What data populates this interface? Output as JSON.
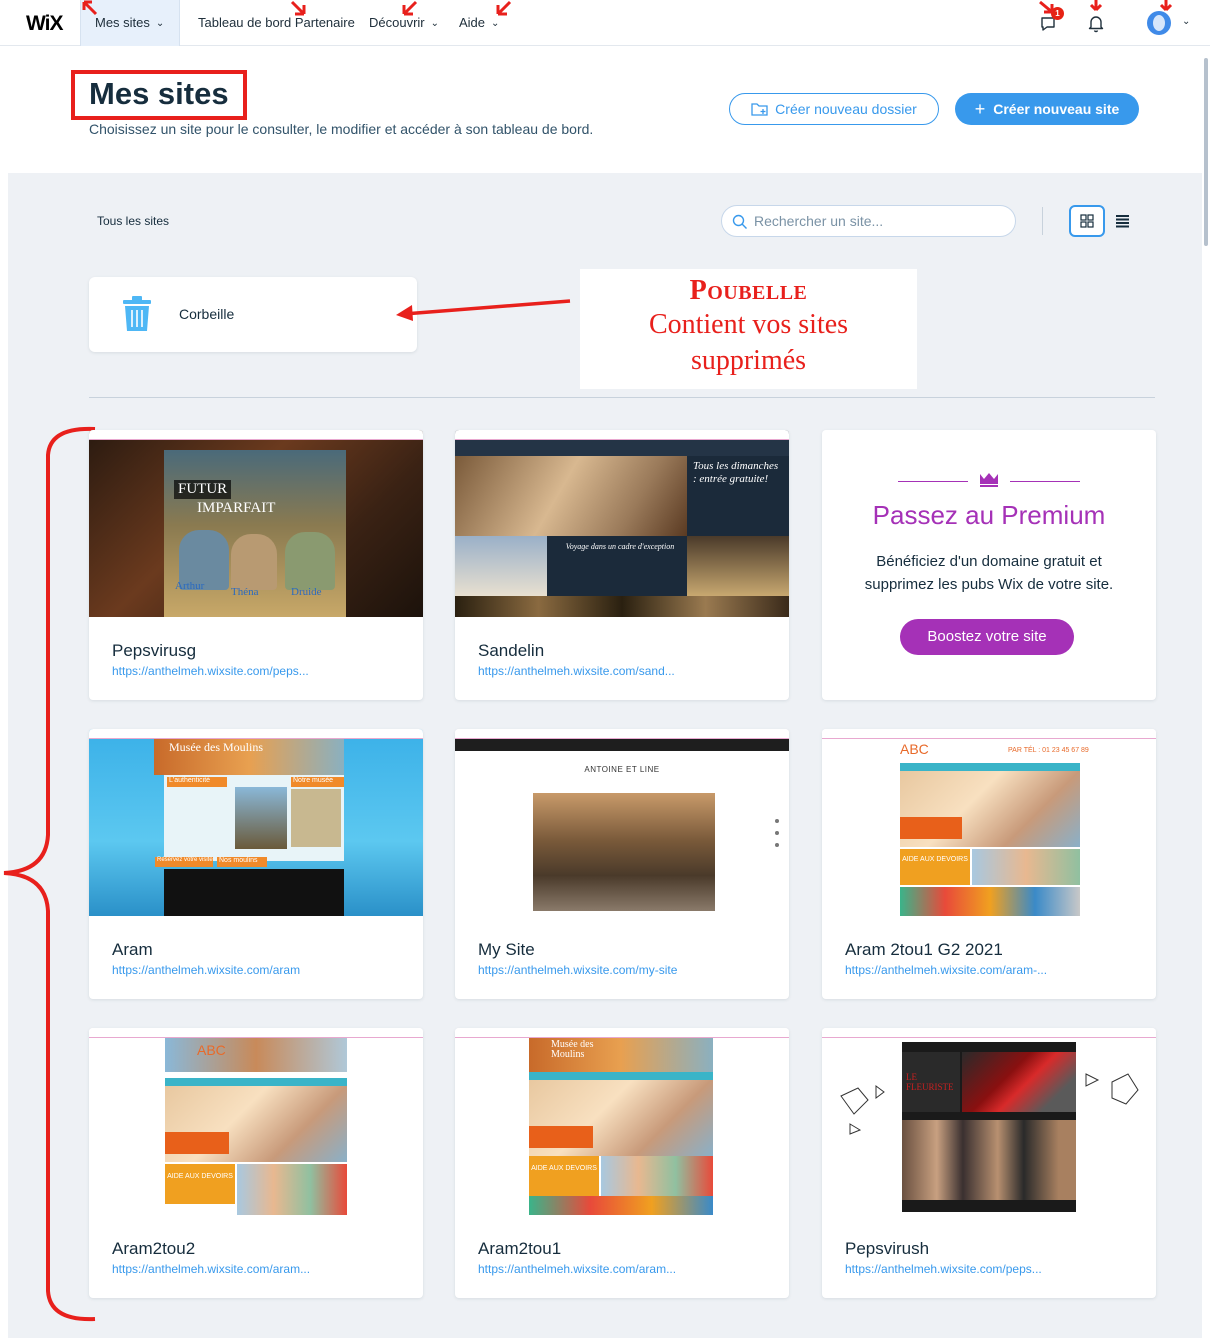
{
  "topbar": {
    "logo": "WiX",
    "nav": [
      {
        "label": "Mes sites"
      },
      {
        "label": "Tableau de bord Partenaire"
      },
      {
        "label": "Découvrir"
      },
      {
        "label": "Aide"
      }
    ],
    "notification_count": "1"
  },
  "header": {
    "title": "Mes sites",
    "subtitle": "Choisissez un site pour le consulter, le modifier et accéder à son tableau de bord.",
    "create_folder_label": "Créer nouveau dossier",
    "create_site_label": "Créer nouveau site"
  },
  "toolbar": {
    "all_sites_label": "Tous les sites",
    "search_placeholder": "Rechercher un site..."
  },
  "trash": {
    "label": "Corbeille"
  },
  "annotation": {
    "title": "Poubelle",
    "line1": "Contient vos sites",
    "line2": "supprimés"
  },
  "sites": [
    {
      "name": "Pepsvirusg",
      "url": "https://anthelmeh.wixsite.com/peps..."
    },
    {
      "name": "Sandelin",
      "url": "https://anthelmeh.wixsite.com/sand..."
    },
    {
      "name": "Aram",
      "url": "https://anthelmeh.wixsite.com/aram"
    },
    {
      "name": "My Site",
      "url": "https://anthelmeh.wixsite.com/my-site"
    },
    {
      "name": "Aram 2tou1 G2 2021",
      "url": "https://anthelmeh.wixsite.com/aram-..."
    },
    {
      "name": "Aram2tou2",
      "url": "https://anthelmeh.wixsite.com/aram..."
    },
    {
      "name": "Aram2tou1",
      "url": "https://anthelmeh.wixsite.com/aram..."
    },
    {
      "name": "Pepsvirush",
      "url": "https://anthelmeh.wixsite.com/peps..."
    }
  ],
  "thumbnails": {
    "futur": {
      "line1": "FUTUR",
      "line2": "IMPARFAIT",
      "c1": "Arthur",
      "c2": "Théna",
      "c3": "Druide"
    },
    "sandelin": {
      "quote": "Tous les dimanches : entrée gratuite!",
      "voyage": "Voyage dans un cadre d'exception"
    },
    "moulins": {
      "title": "Musée des Moulins",
      "auth": "L'authenticité",
      "musee": "Notre musée",
      "reserve": "Réservez votre visite",
      "nos": "Nos moulins"
    },
    "antoine": {
      "title": "ANTOINE ET LINE"
    },
    "abc": {
      "logo": "ABC",
      "tel": "PAR TÉL : 01 23 45 67 89",
      "aide": "AIDE AUX DEVOIRS"
    },
    "fleuriste": {
      "title": "LE FLEURISTE"
    }
  },
  "premium": {
    "title": "Passez au Premium",
    "text": "Bénéficiez d'un domaine gratuit et supprimez les pubs Wix de votre site.",
    "button": "Boostez votre site"
  },
  "colors": {
    "accent": "#3899ec",
    "premium": "#a531b7",
    "annotation": "#e8201c"
  }
}
